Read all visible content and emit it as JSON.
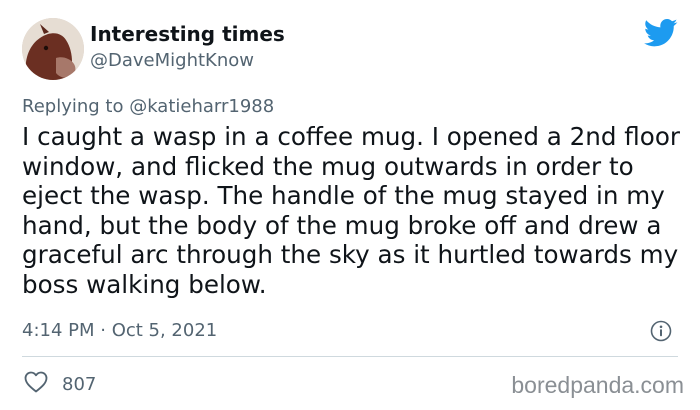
{
  "user": {
    "display_name": "Interesting times",
    "handle": "@DaveMightKnow",
    "avatar_icon": "horse-avatar"
  },
  "reply": {
    "prefix": "Replying to ",
    "mention": "@katieharr1988"
  },
  "tweet": {
    "text": "I caught a wasp in a coffee mug. I opened a 2nd floor window, and flicked the mug outwards in order to eject the wasp. The handle of the mug stayed in my hand, but the body of the mug broke off and drew a graceful arc through the sky as it hurtled towards my boss walking below.",
    "timestamp": "4:14 PM · Oct 5, 2021"
  },
  "actions": {
    "like_icon": "heart-icon",
    "like_count": "807"
  },
  "watermark": "boredpanda.com",
  "colors": {
    "twitter_blue": "#1d9bf0",
    "secondary_text": "#536471",
    "primary_text": "#0f1419",
    "divider": "#cfd9de"
  }
}
